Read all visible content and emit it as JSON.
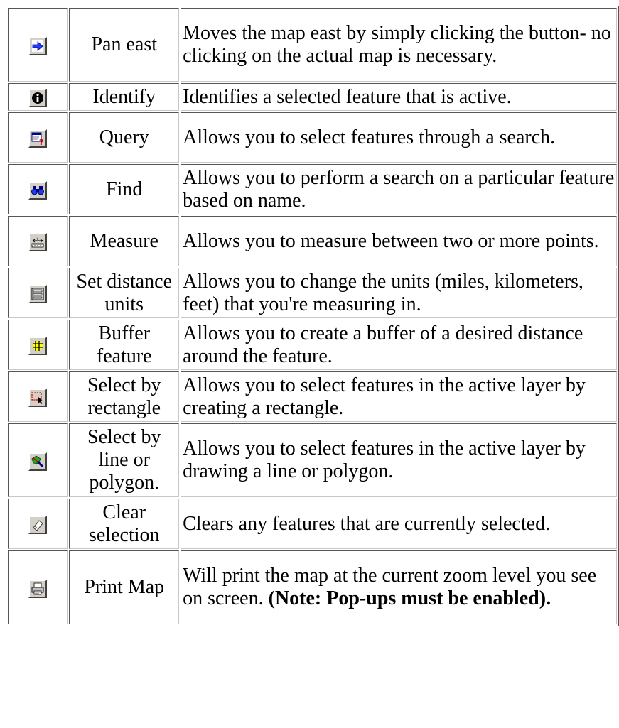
{
  "tools": [
    {
      "icon": "arrow-right-icon",
      "name": "Pan east",
      "description": "Moves the map east by simply clicking the button- no clicking on the actual map is necessary."
    },
    {
      "icon": "info-icon",
      "name": "Identify",
      "description": "Identifies a selected feature that is active."
    },
    {
      "icon": "query-icon",
      "name": "Query",
      "description": "Allows you to select features through a search."
    },
    {
      "icon": "binoculars-icon",
      "name": "Find",
      "description": "Allows you to perform a search on a particular feature based on name."
    },
    {
      "icon": "measure-icon",
      "name": "Measure",
      "description": "Allows you to measure between two or more points."
    },
    {
      "icon": "ruler-units-icon",
      "name": "Set distance units",
      "description": "Allows you to change the units (miles, kilometers, feet) that you're measuring in."
    },
    {
      "icon": "buffer-icon",
      "name": "Buffer feature",
      "description": "Allows you to create a buffer of a desired distance around the feature."
    },
    {
      "icon": "select-rectangle-icon",
      "name": "Select by rectangle",
      "description": "Allows you to select features in the active layer by creating a rectangle."
    },
    {
      "icon": "select-polygon-icon",
      "name": "Select by line or polygon.",
      "description": "Allows you to select features in the active layer by drawing a line or polygon."
    },
    {
      "icon": "eraser-icon",
      "name": "Clear selection",
      "description": "Clears any features that are currently selected."
    },
    {
      "icon": "printer-icon",
      "name": "Print Map",
      "description": "Will print the map at the current zoom level you see on screen. ",
      "note": "(Note: Pop-ups must be enabled)."
    }
  ],
  "colors": {
    "button_face": "#d4d0c8",
    "arrow_blue": "#1c3cff",
    "text": "#000000"
  }
}
